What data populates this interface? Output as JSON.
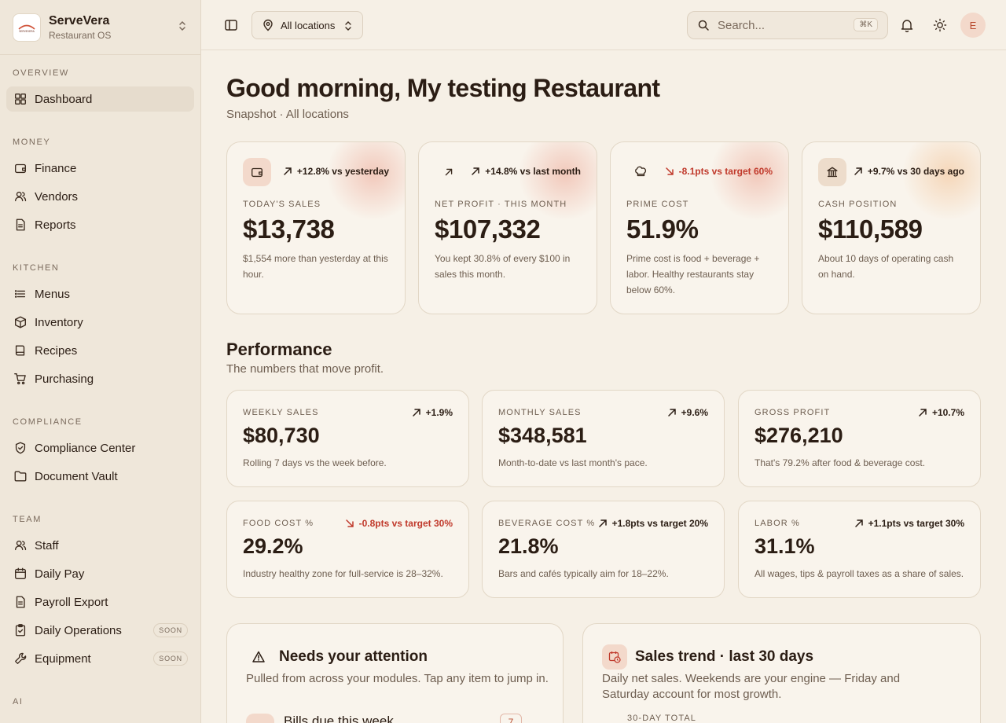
{
  "brand": {
    "name": "ServeVera",
    "subtitle": "Restaurant OS",
    "logo_text": "SERVEVERA"
  },
  "sidebar": {
    "sections": [
      {
        "title": "OVERVIEW",
        "items": [
          {
            "label": "Dashboard",
            "icon": "dashboard-icon",
            "active": true
          }
        ]
      },
      {
        "title": "MONEY",
        "items": [
          {
            "label": "Finance",
            "icon": "wallet-icon"
          },
          {
            "label": "Vendors",
            "icon": "users-icon"
          },
          {
            "label": "Reports",
            "icon": "file-icon"
          }
        ]
      },
      {
        "title": "KITCHEN",
        "items": [
          {
            "label": "Menus",
            "icon": "list-icon"
          },
          {
            "label": "Inventory",
            "icon": "box-icon"
          },
          {
            "label": "Recipes",
            "icon": "book-icon"
          },
          {
            "label": "Purchasing",
            "icon": "cart-icon"
          }
        ]
      },
      {
        "title": "COMPLIANCE",
        "items": [
          {
            "label": "Compliance Center",
            "icon": "shield-check-icon"
          },
          {
            "label": "Document Vault",
            "icon": "folder-icon"
          }
        ]
      },
      {
        "title": "TEAM",
        "items": [
          {
            "label": "Staff",
            "icon": "users-icon"
          },
          {
            "label": "Daily Pay",
            "icon": "calendar-icon"
          },
          {
            "label": "Payroll Export",
            "icon": "file-icon"
          },
          {
            "label": "Daily Operations",
            "icon": "clipboard-check-icon",
            "badge": "SOON"
          },
          {
            "label": "Equipment",
            "icon": "wrench-icon",
            "badge": "SOON"
          }
        ]
      },
      {
        "title": "AI",
        "items": []
      }
    ]
  },
  "topbar": {
    "location": "All locations",
    "search_placeholder": "Search...",
    "shortcut": "⌘K",
    "avatar_initial": "E"
  },
  "header": {
    "greeting": "Good morning, My testing Restaurant",
    "subtitle": "Snapshot · All locations"
  },
  "kpis": [
    {
      "label": "TODAY'S SALES",
      "value": "$13,738",
      "delta": "+12.8% vs yesterday",
      "direction": "up",
      "note": "$1,554 more than yesterday at this hour.",
      "icon": "wallet-icon",
      "icon_bg": "#f3d9cb",
      "glow": "red"
    },
    {
      "label": "NET PROFIT · THIS MONTH",
      "value": "$107,332",
      "delta": "+14.8% vs last month",
      "direction": "up",
      "note": "You kept 30.8% of every $100 in sales this month.",
      "icon": "arrow-up-right-icon",
      "icon_bg": "transparent",
      "glow": "red"
    },
    {
      "label": "PRIME COST",
      "value": "51.9%",
      "delta": "-8.1pts vs target 60%",
      "direction": "down",
      "note": "Prime cost is food + beverage + labor. Healthy restaurants stay below 60%.",
      "icon": "chef-hat-icon",
      "icon_bg": "transparent",
      "glow": "red"
    },
    {
      "label": "CASH POSITION",
      "value": "$110,589",
      "delta": "+9.7% vs 30 days ago",
      "direction": "up",
      "note": "About 10 days of operating cash on hand.",
      "icon": "bank-icon",
      "icon_bg": "#eddccb",
      "glow": "orange"
    }
  ],
  "performance": {
    "title": "Performance",
    "subtitle": "The numbers that move profit.",
    "metrics": [
      {
        "label": "WEEKLY SALES",
        "delta": "+1.9%",
        "direction": "up",
        "value": "$80,730",
        "note": "Rolling 7 days vs the week before."
      },
      {
        "label": "MONTHLY SALES",
        "delta": "+9.6%",
        "direction": "up",
        "value": "$348,581",
        "note": "Month-to-date vs last month's pace."
      },
      {
        "label": "GROSS PROFIT",
        "delta": "+10.7%",
        "direction": "up",
        "value": "$276,210",
        "note": "That's 79.2% after food & beverage cost."
      },
      {
        "label": "FOOD COST %",
        "delta": "-0.8pts vs target 30%",
        "direction": "down",
        "value": "29.2%",
        "note": "Industry healthy zone for full-service is 28–32%."
      },
      {
        "label": "BEVERAGE COST %",
        "delta": "+1.8pts vs target 20%",
        "direction": "up",
        "value": "21.8%",
        "note": "Bars and cafés typically aim for 18–22%."
      },
      {
        "label": "LABOR %",
        "delta": "+1.1pts vs target 30%",
        "direction": "up",
        "value": "31.1%",
        "note": "All wages, tips & payroll taxes as a share of sales."
      }
    ]
  },
  "attention": {
    "title": "Needs your attention",
    "subtitle": "Pulled from across your modules. Tap any item to jump in.",
    "first_item": "Bills due this week",
    "first_count": "7"
  },
  "trend": {
    "title": "Sales trend · last 30 days",
    "subtitle": "Daily net sales. Weekends are your engine — Friday and Saturday account for most growth.",
    "stat_label": "30-DAY TOTAL"
  },
  "colors": {
    "accent": "#c0392b",
    "background": "#f6f0e6",
    "card": "#f9f4ec"
  }
}
